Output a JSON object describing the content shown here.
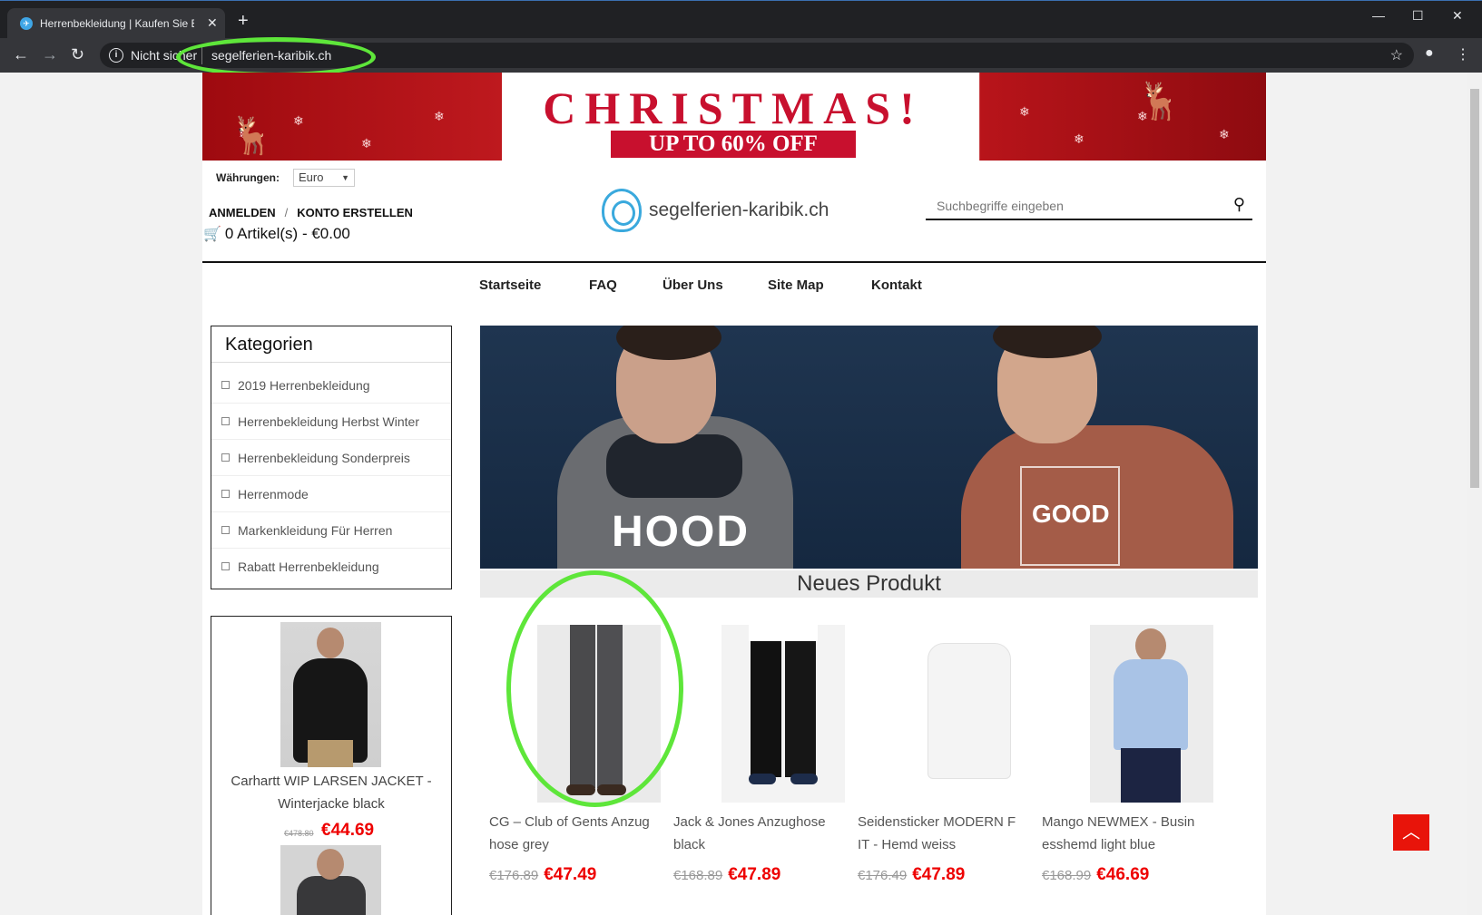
{
  "browser": {
    "tab_title": "Herrenbekleidung | Kaufen Sie Bi",
    "security": "Nicht sicher",
    "url": "segelferien-karibik.ch"
  },
  "banner": {
    "headline": "CHRISTMAS!",
    "subline": "UP TO 60% OFF"
  },
  "header": {
    "currency_label": "Währungen:",
    "currency_value": "Euro",
    "login": "ANMELDEN",
    "create_account": "KONTO ERSTELLEN",
    "cart": "0 Artikel(s) - €0.00",
    "logo_text": "segelferien-karibik.ch",
    "search_placeholder": "Suchbegriffe eingeben"
  },
  "nav": [
    "Startseite",
    "FAQ",
    "Über Uns",
    "Site Map",
    "Kontakt"
  ],
  "sidebar": {
    "title": "Kategorien",
    "categories": [
      "2019 Herrenbekleidung",
      "Herrenbekleidung Herbst Winter",
      "Herrenbekleidung Sonderpreis",
      "Herrenmode",
      "Markenkleidung Für Herren",
      "Rabatt Herrenbekleidung"
    ],
    "featured": {
      "name": "Carhartt WIP LARSEN JACKET - Winterjacke black",
      "old_price": "€478.80",
      "price": "€44.69"
    }
  },
  "hero": {
    "left_text": "HOOD",
    "right_text": "GOOD"
  },
  "section_title": "Neues Produkt",
  "products": [
    {
      "name": "CG – Club of Gents Anzug hose grey",
      "old_price": "€176.89",
      "price": "€47.49"
    },
    {
      "name": "Jack & Jones Anzughose black",
      "old_price": "€168.89",
      "price": "€47.89"
    },
    {
      "name": "Seidensticker MODERN F IT - Hemd weiss",
      "old_price": "€176.49",
      "price": "€47.89"
    },
    {
      "name": "Mango NEWMEX - Busin esshemd light blue",
      "old_price": "€168.99",
      "price": "€46.69"
    }
  ]
}
